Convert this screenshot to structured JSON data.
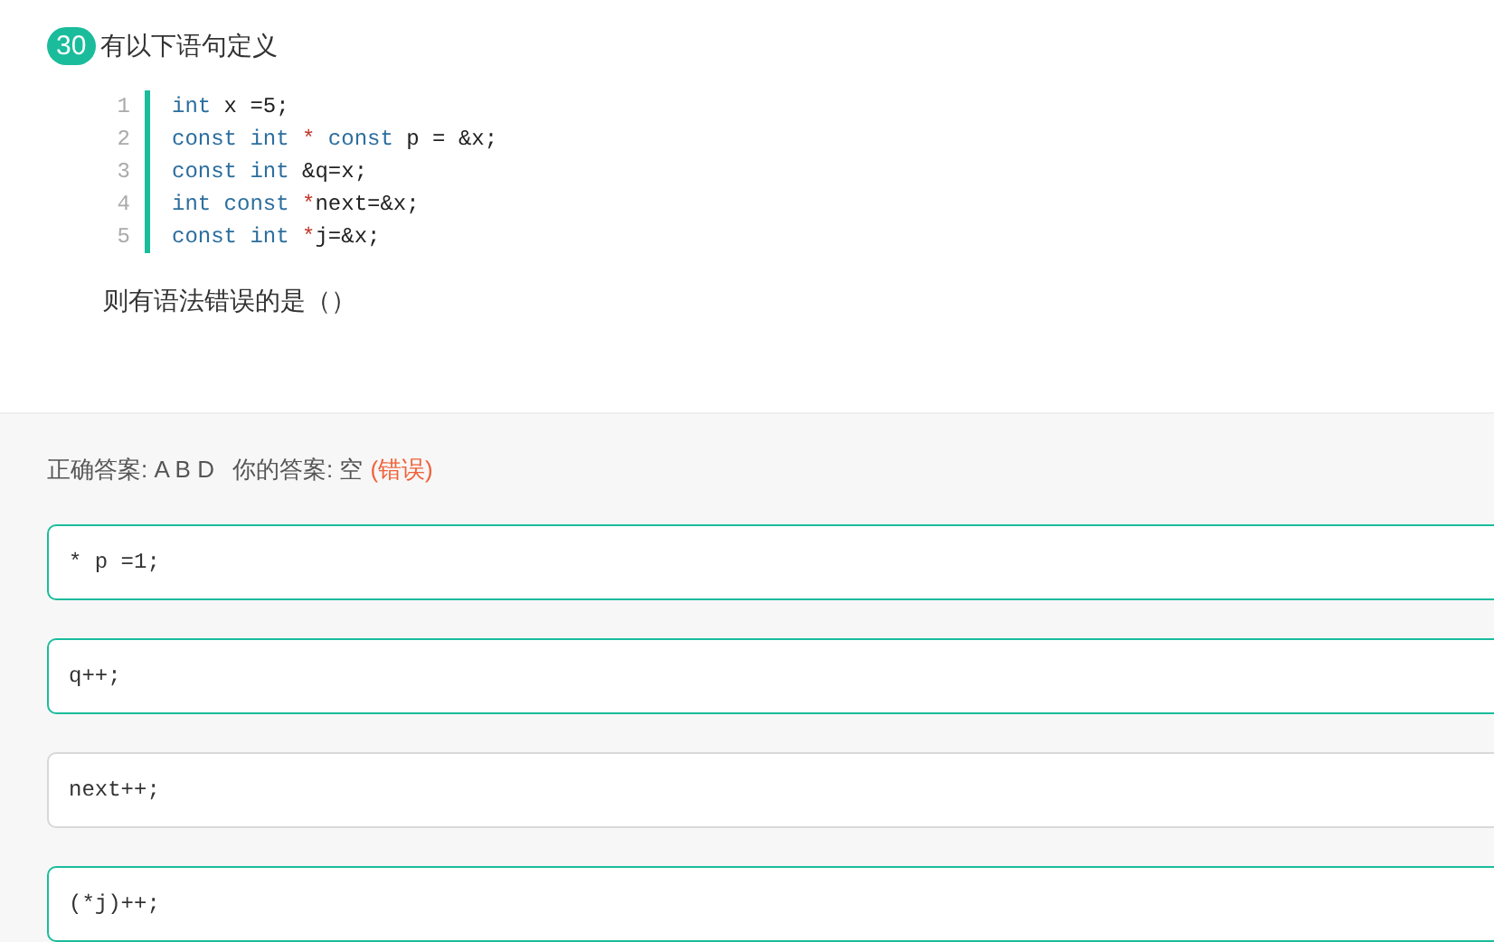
{
  "question": {
    "number": "30",
    "title": "有以下语句定义",
    "code": [
      {
        "line_number": "1",
        "tokens": [
          {
            "kind": "keyword",
            "text": "int"
          },
          {
            "kind": "plain",
            "text": " x =5;"
          }
        ]
      },
      {
        "line_number": "2",
        "tokens": [
          {
            "kind": "keyword",
            "text": "const int"
          },
          {
            "kind": "operator",
            "text": " * "
          },
          {
            "kind": "keyword",
            "text": "const"
          },
          {
            "kind": "plain",
            "text": " p = &x;"
          }
        ]
      },
      {
        "line_number": "3",
        "tokens": [
          {
            "kind": "keyword",
            "text": "const int"
          },
          {
            "kind": "plain",
            "text": " &q=x;"
          }
        ]
      },
      {
        "line_number": "4",
        "tokens": [
          {
            "kind": "keyword",
            "text": "int const"
          },
          {
            "kind": "operator",
            "text": " *"
          },
          {
            "kind": "plain",
            "text": "next=&x;"
          }
        ]
      },
      {
        "line_number": "5",
        "tokens": [
          {
            "kind": "keyword",
            "text": "const int"
          },
          {
            "kind": "operator",
            "text": " *"
          },
          {
            "kind": "plain",
            "text": "j=&x;"
          }
        ]
      }
    ],
    "prompt": "则有语法错误的是（）"
  },
  "result": {
    "correct_answer_label": "正确答案: A B D",
    "your_answer_label": "你的答案: 空",
    "verdict": "(错误)"
  },
  "options": [
    {
      "text": "* p =1;",
      "correct": true
    },
    {
      "text": "q++;",
      "correct": true
    },
    {
      "text": "next++;",
      "correct": false
    },
    {
      "text": "(*j)++;",
      "correct": true
    }
  ]
}
